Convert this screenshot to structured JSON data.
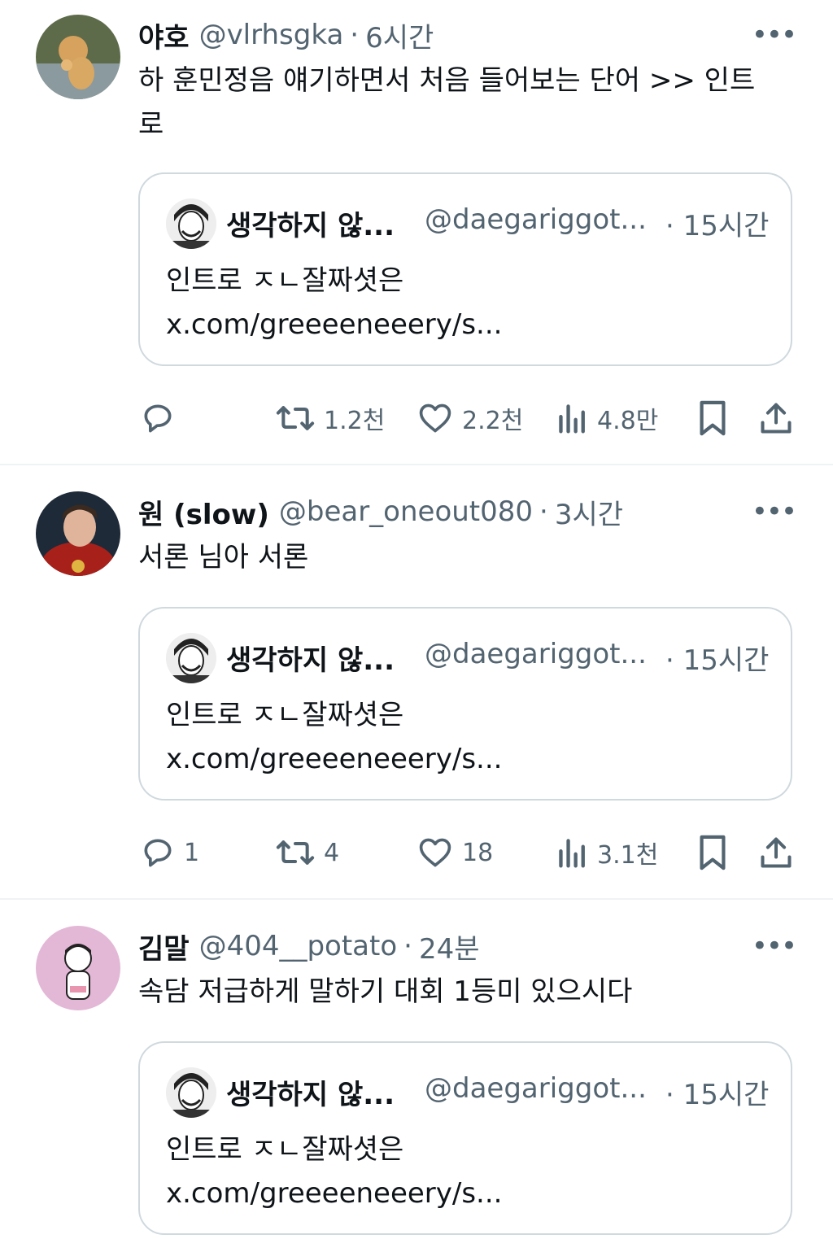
{
  "tweets": [
    {
      "name": "야호",
      "handle": "@vlrhsgka",
      "dot": "·",
      "time": "6시간",
      "more": "•••",
      "text_line1": "하 훈민정음 얘기하면서 처음 들어보는 단어 >> 인트",
      "text_line2": "로",
      "quote": {
        "name": "생각하지 않...",
        "handle": "@daegariggot...",
        "time": "· 15시간",
        "line1": "인트로 ㅈㄴ잘짜셧은",
        "line2": "x.com/greeeeneeery/s..."
      },
      "actions": {
        "replies": "",
        "retweets": "1.2천",
        "likes": "2.2천",
        "views": "4.8만"
      }
    },
    {
      "name": "원 (slow)",
      "handle": "@bear_oneout080",
      "dot": "·",
      "time": "3시간",
      "more": "•••",
      "text_line1": "서론 님아 서론",
      "quote": {
        "name": "생각하지 않...",
        "handle": "@daegariggot...",
        "time": "· 15시간",
        "line1": "인트로 ㅈㄴ잘짜셧은",
        "line2": "x.com/greeeeneeery/s..."
      },
      "actions": {
        "replies": "1",
        "retweets": "4",
        "likes": "18",
        "views": "3.1천"
      }
    },
    {
      "name": "김말",
      "handle": "@404__potato",
      "dot": "·",
      "time": "24분",
      "more": "•••",
      "text_line1": "속담 저급하게 말하기 대회 1등미 있으시다",
      "quote": {
        "name": "생각하지 않...",
        "handle": "@daegariggot...",
        "time": "· 15시간",
        "line1": "인트로 ㅈㄴ잘짜셧은",
        "line2": "x.com/greeeeneeery/s..."
      }
    }
  ],
  "icons": {
    "reply": "reply-icon",
    "retweet": "retweet-icon",
    "like": "heart-icon",
    "views": "views-icon",
    "bookmark": "bookmark-icon",
    "share": "share-icon"
  },
  "colors": {
    "text": "#0f1419",
    "secondary": "#536471",
    "border": "#cfd9de",
    "divider": "#eff3f4"
  }
}
